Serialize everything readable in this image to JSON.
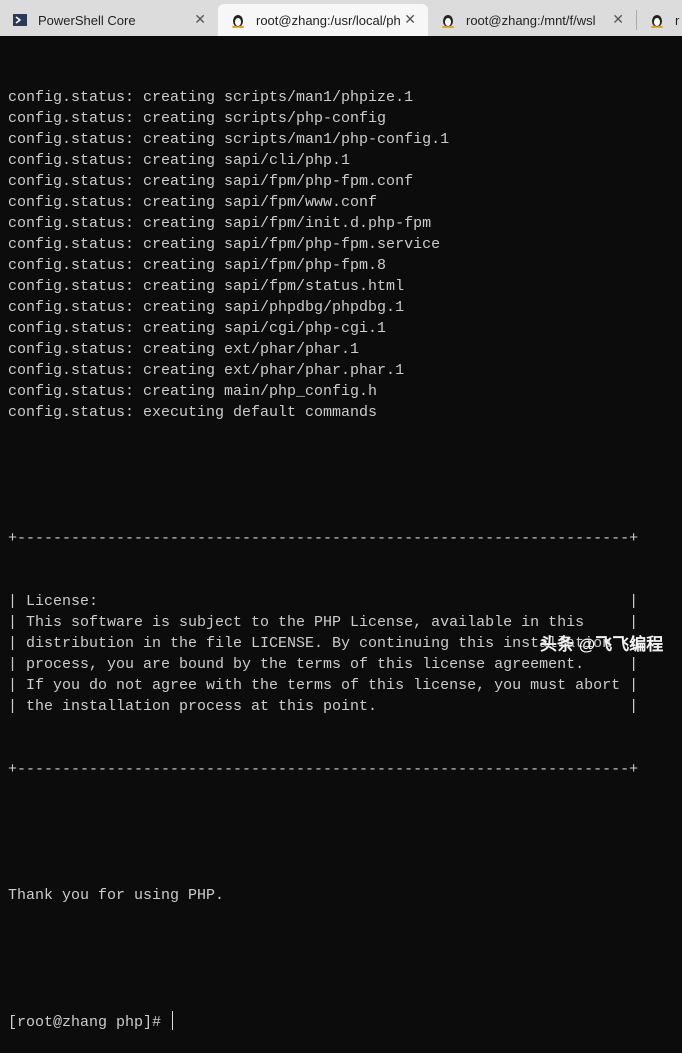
{
  "tabs": [
    {
      "label": "PowerShell Core",
      "icon": "powershell-icon"
    },
    {
      "label": "root@zhang:/usr/local/ph",
      "icon": "linux-penguin-icon",
      "active": true
    },
    {
      "label": "root@zhang:/mnt/f/wsl",
      "icon": "linux-penguin-icon"
    },
    {
      "label": "r",
      "icon": "linux-penguin-icon"
    }
  ],
  "output": [
    "config.status: creating scripts/man1/phpize.1",
    "config.status: creating scripts/php-config",
    "config.status: creating scripts/man1/php-config.1",
    "config.status: creating sapi/cli/php.1",
    "config.status: creating sapi/fpm/php-fpm.conf",
    "config.status: creating sapi/fpm/www.conf",
    "config.status: creating sapi/fpm/init.d.php-fpm",
    "config.status: creating sapi/fpm/php-fpm.service",
    "config.status: creating sapi/fpm/php-fpm.8",
    "config.status: creating sapi/fpm/status.html",
    "config.status: creating sapi/phpdbg/phpdbg.1",
    "config.status: creating sapi/cgi/php-cgi.1",
    "config.status: creating ext/phar/phar.1",
    "config.status: creating ext/phar/phar.phar.1",
    "config.status: creating main/php_config.h",
    "config.status: executing default commands"
  ],
  "license": [
    "License:",
    "This software is subject to the PHP License, available in this",
    "distribution in the file LICENSE. By continuing this installation",
    "process, you are bound by the terms of this license agreement.",
    "If you do not agree with the terms of this license, you must abort",
    "the installation process at this point."
  ],
  "thanks": "Thank you for using PHP.",
  "prompt": "[root@zhang php]#",
  "watermark": "头条 @飞飞编程"
}
